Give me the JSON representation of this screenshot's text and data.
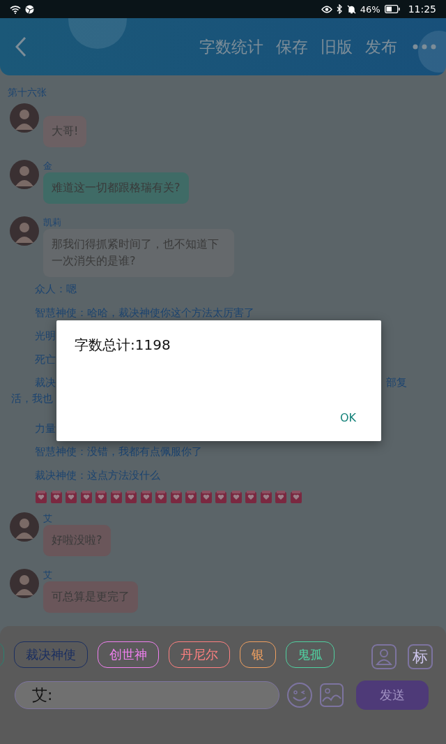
{
  "status_bar": {
    "battery": "46%",
    "time": "11:25"
  },
  "header": {
    "actions": [
      "字数统计",
      "保存",
      "旧版",
      "发布"
    ]
  },
  "chapter": "第十六张",
  "messages": [
    {
      "text": "大哥!",
      "color": "#6c6063"
    },
    {
      "name": "金",
      "text": "难道这一切都跟格瑞有关?",
      "color": "#3f6b66"
    },
    {
      "name": "凯莉",
      "text": "那我们得抓紧时间了，也不知道下一次消失的是谁?",
      "color": "#65696c"
    }
  ],
  "narration": [
    {
      "text": "众人：嗯"
    },
    {
      "text": "智慧神使：哈哈，裁决神使你这个方法太厉害了"
    },
    {
      "text": "光明"
    },
    {
      "text": "死亡"
    },
    {
      "text": "裁决",
      "tail": "部复",
      "wrap": "活，我也"
    },
    {
      "text": "力量"
    },
    {
      "text": "智慧神使：没错，我都有点佩服你了"
    },
    {
      "text": "裁决神使：这点方法没什么"
    }
  ],
  "stickers": [
    {
      "kind": "heart"
    },
    {
      "kind": "heart"
    },
    {
      "kind": "heart"
    },
    {
      "kind": "heart"
    },
    {
      "kind": "heart"
    },
    {
      "kind": "heart"
    },
    {
      "kind": "heart"
    },
    {
      "kind": "heart"
    },
    {
      "kind": "heart"
    },
    {
      "kind": "heart"
    },
    {
      "kind": "heart"
    },
    {
      "kind": "heart"
    },
    {
      "kind": "heart"
    },
    {
      "kind": "heart"
    },
    {
      "kind": "heart"
    },
    {
      "kind": "heart"
    },
    {
      "kind": "heart"
    },
    {
      "kind": "heart"
    }
  ],
  "messages_after": [
    {
      "name": "艾",
      "text": "好啦没啦?",
      "color": "#6a565a"
    },
    {
      "name": "艾",
      "text": "可总算是更完了",
      "color": "#6a565a"
    }
  ],
  "characters": [
    {
      "color": "#2a8070"
    },
    {
      "label": "裁决神使",
      "color": "#1a2e60"
    },
    {
      "label": "创世神",
      "color": "#f080f0"
    },
    {
      "label": "丹尼尔",
      "color": "#ff8080"
    },
    {
      "label": "银",
      "color": "#f0a060"
    },
    {
      "label": "鬼孤",
      "color": "#50d0a0"
    }
  ],
  "tag_button": "标",
  "input": {
    "value": "艾:"
  },
  "send_button": "发送",
  "dialog": {
    "message": "字数总计:1198",
    "button": "OK"
  }
}
